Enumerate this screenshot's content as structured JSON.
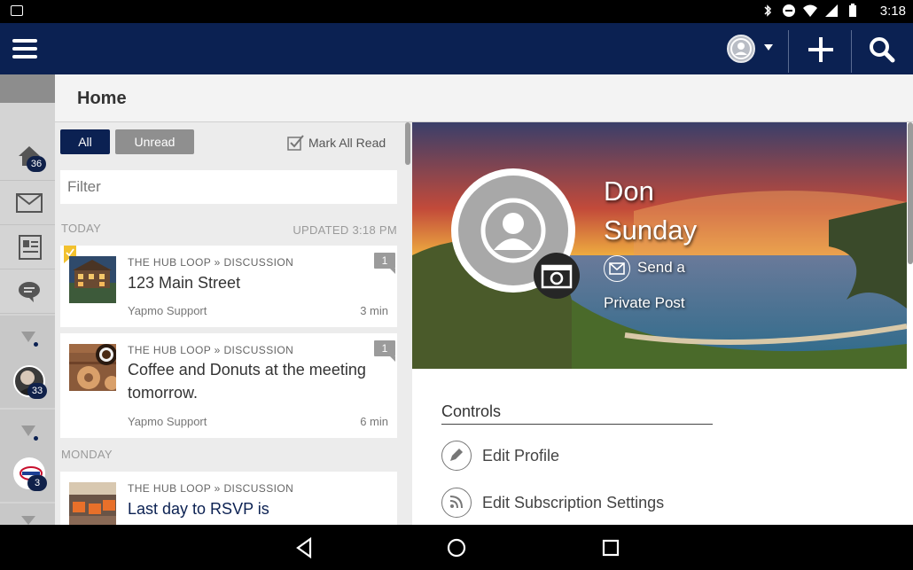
{
  "status_bar": {
    "time": "3:18"
  },
  "app_bar": {
    "menu_icon": "hamburger-icon",
    "account_icon": "user-circle-icon",
    "add_icon": "plus-icon",
    "search_icon": "search-icon",
    "bg": "#0b2152"
  },
  "rail": {
    "home_badge": "36",
    "group1_badge": "33",
    "group2_badge": "3"
  },
  "header": {
    "title": "Home"
  },
  "feed": {
    "tab_all": "All",
    "tab_unread": "Unread",
    "mark_all_read": "Mark All Read",
    "filter_placeholder": "Filter",
    "sections": [
      {
        "label": "TODAY",
        "updated": "UPDATED 3:18 PM"
      },
      {
        "label": "MONDAY"
      }
    ],
    "cards": [
      {
        "source": "THE HUB LOOP » DISCUSSION",
        "title": "123 Main Street",
        "author": "Yapmo Support",
        "time": "3 min",
        "count": "1"
      },
      {
        "source": "THE HUB LOOP » DISCUSSION",
        "title": "Coffee and Donuts at the meeting tomorrow.",
        "author": "Yapmo Support",
        "time": "6 min",
        "count": "1"
      },
      {
        "source": "THE HUB LOOP » DISCUSSION",
        "title": "Last day to RSVP is"
      }
    ]
  },
  "profile": {
    "name_first": "Don",
    "name_last": "Sunday",
    "send_line1": "Send a",
    "send_line2": "Private Post",
    "controls_title": "Controls",
    "controls": [
      {
        "label": "Edit Profile",
        "icon": "pencil-icon"
      },
      {
        "label": "Edit Subscription Settings",
        "icon": "rss-icon"
      }
    ]
  }
}
